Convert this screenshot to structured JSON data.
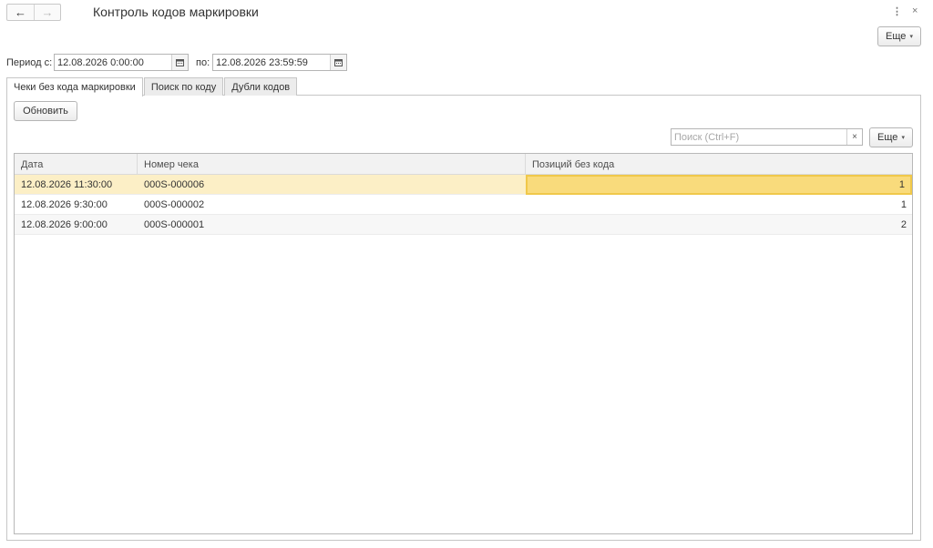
{
  "window": {
    "title": "Контроль кодов маркировки",
    "back_icon": "←",
    "forward_icon": "→",
    "more_icon": "⋮",
    "close_icon": "×"
  },
  "toolbar": {
    "more_label": "Еще",
    "caret": "▾"
  },
  "period": {
    "from_label": "Период с:",
    "from_value": "12.08.2026  0:00:00",
    "to_label": "по:",
    "to_value": "12.08.2026 23:59:59"
  },
  "tabs": [
    {
      "label": "Чеки без кода маркировки",
      "active": true
    },
    {
      "label": "Поиск по коду",
      "active": false
    },
    {
      "label": "Дубли кодов",
      "active": false
    }
  ],
  "panel": {
    "refresh_label": "Обновить",
    "search_placeholder": "Поиск (Ctrl+F)",
    "search_clear": "×",
    "more_label": "Еще"
  },
  "table": {
    "columns": [
      "Дата",
      "Номер чека",
      "Позиций без кода"
    ],
    "rows": [
      {
        "date": "12.08.2026 11:30:00",
        "number": "000S-000006",
        "count": "1"
      },
      {
        "date": "12.08.2026 9:30:00",
        "number": "000S-000002",
        "count": "1"
      },
      {
        "date": "12.08.2026 9:00:00",
        "number": "000S-000001",
        "count": "2"
      }
    ],
    "selected_row": 0
  },
  "colors": {
    "selected_row": "#fcefc6",
    "selected_cell": "#f9db7c",
    "selected_cell_border": "#f0c84a"
  }
}
